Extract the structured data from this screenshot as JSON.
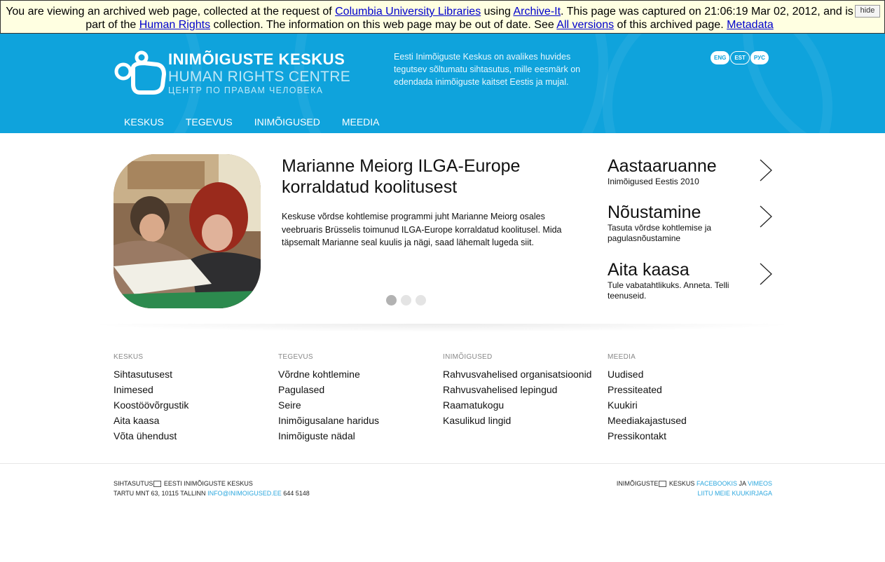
{
  "archive": {
    "t1": "You are viewing an archived web page, collected at the request of ",
    "l1": "Columbia University Libraries",
    "t2": " using ",
    "l2": "Archive-It",
    "t3": ". This page was captured on 21:06:19 Mar 02, 2012, and is part of the ",
    "l3": "Human Rights",
    "t4": " collection. The information on this web page may be out of date. See ",
    "l4": "All versions",
    "t5": " of this archived page. ",
    "l5": "Metadata",
    "hide": "hide"
  },
  "header": {
    "logo_title": "INIMÕIGUSTE KESKUS",
    "logo_sub1": "HUMAN RIGHTS CENTRE",
    "logo_sub2": "ЦЕНТР ПО ПРАВАМ ЧЕЛОВЕКА",
    "intro": "Eesti Inimõiguste Keskus on avalikes huvides tegutsev sõltumatu sihtasutus, mille eesmärk on edendada inimõiguste kaitset Eestis ja mujal.",
    "languages": [
      "ENG",
      "EST",
      "РУС"
    ],
    "active_language": "EST",
    "nav": [
      "KESKUS",
      "TEGEVUS",
      "INIMÕIGUSED",
      "MEEDIA"
    ]
  },
  "feature": {
    "title": "Marianne Meiorg ILGA-Europe korraldatud koolitusest",
    "text": "Keskuse võrdse kohtlemise programmi juht Marianne Meiorg osales veebruaris Brüsselis toimunud ILGA-Europe korraldatud koolitusel. Mida täpsemalt Marianne seal kuulis ja nägi, saad lähemalt lugeda siit.",
    "slides_total": 3,
    "active_slide": 1
  },
  "side": [
    {
      "title": "Aastaaruanne",
      "sub": "Inimõigused Eestis 2010"
    },
    {
      "title": "Nõustamine",
      "sub": "Tasuta võrdse kohtlemise ja pagulasnõustamine"
    },
    {
      "title": "Aita kaasa",
      "sub": "Tule vabatahtlikuks. Anneta. Telli teenuseid."
    }
  ],
  "sitemap": [
    {
      "head": "KESKUS",
      "links": [
        "Sihtasutusest",
        "Inimesed",
        "Koostöövõrgustik",
        "Aita kaasa",
        "Võta ühendust"
      ]
    },
    {
      "head": "TEGEVUS",
      "links": [
        "Võrdne kohtlemine",
        "Pagulased",
        "Seire",
        "Inimõigusalane haridus",
        "Inimõiguste nädal"
      ]
    },
    {
      "head": "INIMÕIGUSED",
      "links": [
        "Rahvusvahelised organisatsioonid",
        "Rahvusvahelised lepingud",
        "Raamatukogu",
        "Kasulikud lingid"
      ]
    },
    {
      "head": "MEEDIA",
      "links": [
        "Uudised",
        "Pressiteated",
        "Kuukiri",
        "Meediakajastused",
        "Pressikontakt"
      ]
    }
  ],
  "footer": {
    "left1a": "SIHTASUTUS",
    "left1b": " EESTI INIMÕIGUSTE KESKUS",
    "left2": "TARTU MNT 63, 10115 TALLINN ",
    "email": "INFO@INIMOIGUSED.EE",
    "phone": " 644 5148",
    "right1a": "INIMÕIGUSTE",
    "right1b": " KESKUS ",
    "facebook": "FACEBOOKIS",
    "ja": " JA ",
    "vimeo": "VIMEOS",
    "newsletter": "LIITU MEIE KUUKIRJAGA"
  },
  "colors": {
    "header_blue": "#0fa3dc",
    "link_blue": "#2ba7de",
    "banner_bg": "#ffffe1"
  }
}
